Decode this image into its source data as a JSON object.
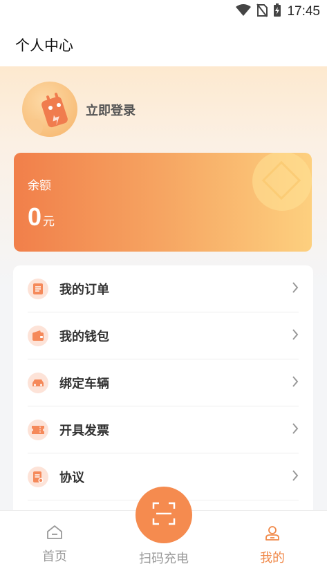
{
  "status_bar": {
    "time": "17:45",
    "icons": [
      "wifi-icon",
      "no-sim-icon",
      "battery-charging-icon"
    ]
  },
  "header": {
    "title": "个人中心"
  },
  "profile": {
    "login_text": "立即登录",
    "avatar_icon": "avatar-icon"
  },
  "balance": {
    "label": "余额",
    "amount": "0",
    "unit": "元"
  },
  "menu": {
    "items": [
      {
        "label": "我的订单",
        "icon": "order-icon"
      },
      {
        "label": "我的钱包",
        "icon": "wallet-icon"
      },
      {
        "label": "绑定车辆",
        "icon": "car-icon"
      },
      {
        "label": "开具发票",
        "icon": "invoice-icon"
      },
      {
        "label": "协议",
        "icon": "agreement-icon"
      }
    ]
  },
  "tabbar": {
    "home": "首页",
    "scan": "扫码充电",
    "mine": "我的",
    "active": "mine"
  },
  "colors": {
    "accent": "#f58b4f",
    "accent_light": "#fde3d8",
    "card_start": "#f17f4a",
    "card_end": "#fdd07f"
  }
}
